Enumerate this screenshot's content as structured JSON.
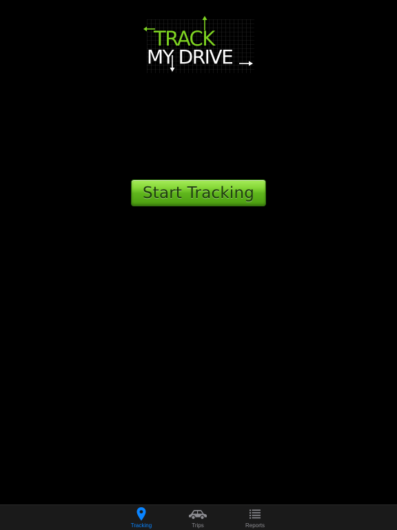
{
  "logo": {
    "line1": "TRACK",
    "line2": "MY DRIVE",
    "colors": {
      "track": "#7ed321",
      "mydrive": "#ffffff",
      "grid": "#3a3a3a"
    }
  },
  "main": {
    "start_button_label": "Start Tracking"
  },
  "tabbar": {
    "tabs": [
      {
        "label": "Tracking",
        "icon": "location-pin-icon",
        "active": true
      },
      {
        "label": "Trips",
        "icon": "car-icon",
        "active": false
      },
      {
        "label": "Reports",
        "icon": "list-icon",
        "active": false
      }
    ],
    "colors": {
      "active": "#0a84ff",
      "inactive": "#8e8e93"
    }
  }
}
